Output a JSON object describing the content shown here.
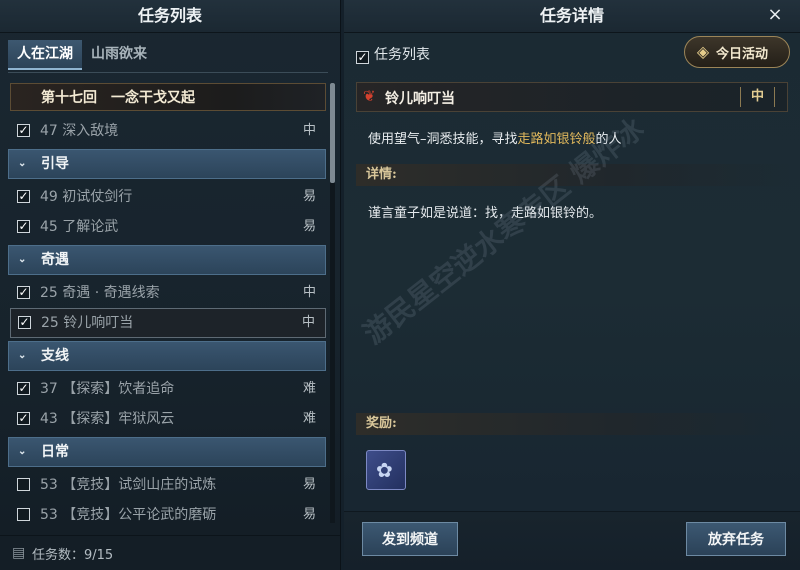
{
  "left_panel": {
    "title": "任务列表",
    "tabs": [
      {
        "label": "人在江湖",
        "active": true
      },
      {
        "label": "山雨欲来",
        "active": false
      }
    ],
    "chapter": "第十七回　一念干戈又起",
    "items_top": [
      {
        "num": "47",
        "name": "深入敌境",
        "diff": "中",
        "checked": true
      }
    ],
    "sections": [
      {
        "label": "引导",
        "items": [
          {
            "num": "49",
            "name": "初试仗剑行",
            "diff": "易",
            "checked": true
          },
          {
            "num": "45",
            "name": "了解论武",
            "diff": "易",
            "checked": true
          }
        ]
      },
      {
        "label": "奇遇",
        "items": [
          {
            "num": "25",
            "name": "奇遇 · 奇遇线索",
            "diff": "中",
            "checked": true
          },
          {
            "num": "25",
            "name": "铃儿响叮当",
            "diff": "中",
            "checked": true,
            "selected": true
          }
        ]
      },
      {
        "label": "支线",
        "items": [
          {
            "num": "37",
            "name": "【探索】饮者追命",
            "diff": "难",
            "checked": true
          },
          {
            "num": "43",
            "name": "【探索】牢狱风云",
            "diff": "难",
            "checked": true
          }
        ]
      },
      {
        "label": "日常",
        "items": [
          {
            "num": "53",
            "name": "【竞技】试剑山庄的试炼",
            "diff": "易",
            "checked": false
          },
          {
            "num": "53",
            "name": "【竞技】公平论武的磨砺",
            "diff": "易",
            "checked": false
          }
        ]
      }
    ],
    "footer_count": "任务数：9/15"
  },
  "right_panel": {
    "title": "任务详情",
    "close_icon": "×",
    "task_list_toggle": "任务列表",
    "today_button": "今日活动",
    "quest_name": "铃儿响叮当",
    "quest_difficulty": "中",
    "description_prefix": "使用望气–洞悉技能，寻找",
    "description_highlight": "走路如银铃般",
    "description_suffix": "的人",
    "details_header": "详情:",
    "details_text": "谨言童子如是说道：找，走路如银铃的。",
    "rewards_header": "奖励:",
    "buttons": {
      "send": "发到频道",
      "abandon": "放弃任务"
    }
  },
  "watermark": "游民星空逆水寒专区 爆炸冰",
  "colors": {
    "highlight": "#e1b85c",
    "accent_blue": "#3a5670",
    "difficulty_gold": "#e2cc92"
  }
}
